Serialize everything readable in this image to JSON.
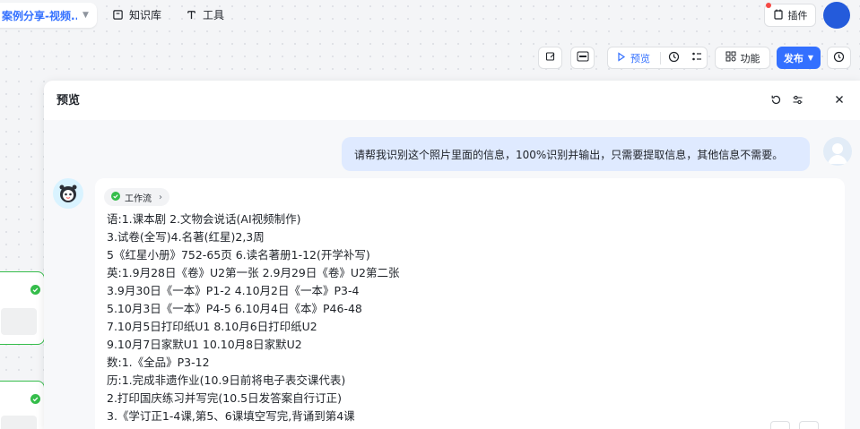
{
  "topbar": {
    "project_name": "案例分享-视频...",
    "nav": [
      {
        "label": "知识库",
        "icon": "book-icon"
      },
      {
        "label": "工具",
        "icon": "tool-icon"
      }
    ],
    "plugin_label": "插件"
  },
  "toolbar": {
    "preview_label": "预览",
    "function_label": "功能",
    "publish_label": "发布"
  },
  "panel": {
    "title": "预览",
    "user_message": "请帮我识别这个照片里面的信息，100%识别并输出，只需要提取信息，其他信息不需要。",
    "workflow_label": "工作流",
    "response_lines": [
      "语:1.课本剧 2.文物会说话(AI视频制作)",
      "3.试卷(全写)4.名著(红星)2,3周",
      "5《红星小册》752-65页 6.读名著册1-12(开学补写)",
      "英:1.9月28日《卷》U2第一张 2.9月29日《卷》U2第二张",
      "3.9月30日《一本》P1-2 4.10月2日《一本》P3-4",
      "5.10月3日《一本》P4-5 6.10月4日《本》P46-48",
      "7.10月5日打印纸U1 8.10月6日打印纸U2",
      "9.10月7日家默U1 10.10月8日家默U2",
      "数:1.《全品》P3-12",
      "历:1.完成非遗作业(10.9日前将电子表交课代表)",
      "2.打印国庆练习并写完(10.5日发答案自行订正)",
      "3.《学订正1-4课,第5、6课填空写完,背诵到第4课"
    ]
  },
  "colors": {
    "accent": "#3370ff",
    "success": "#35bd4b",
    "user_bubble": "#dfeaff"
  }
}
